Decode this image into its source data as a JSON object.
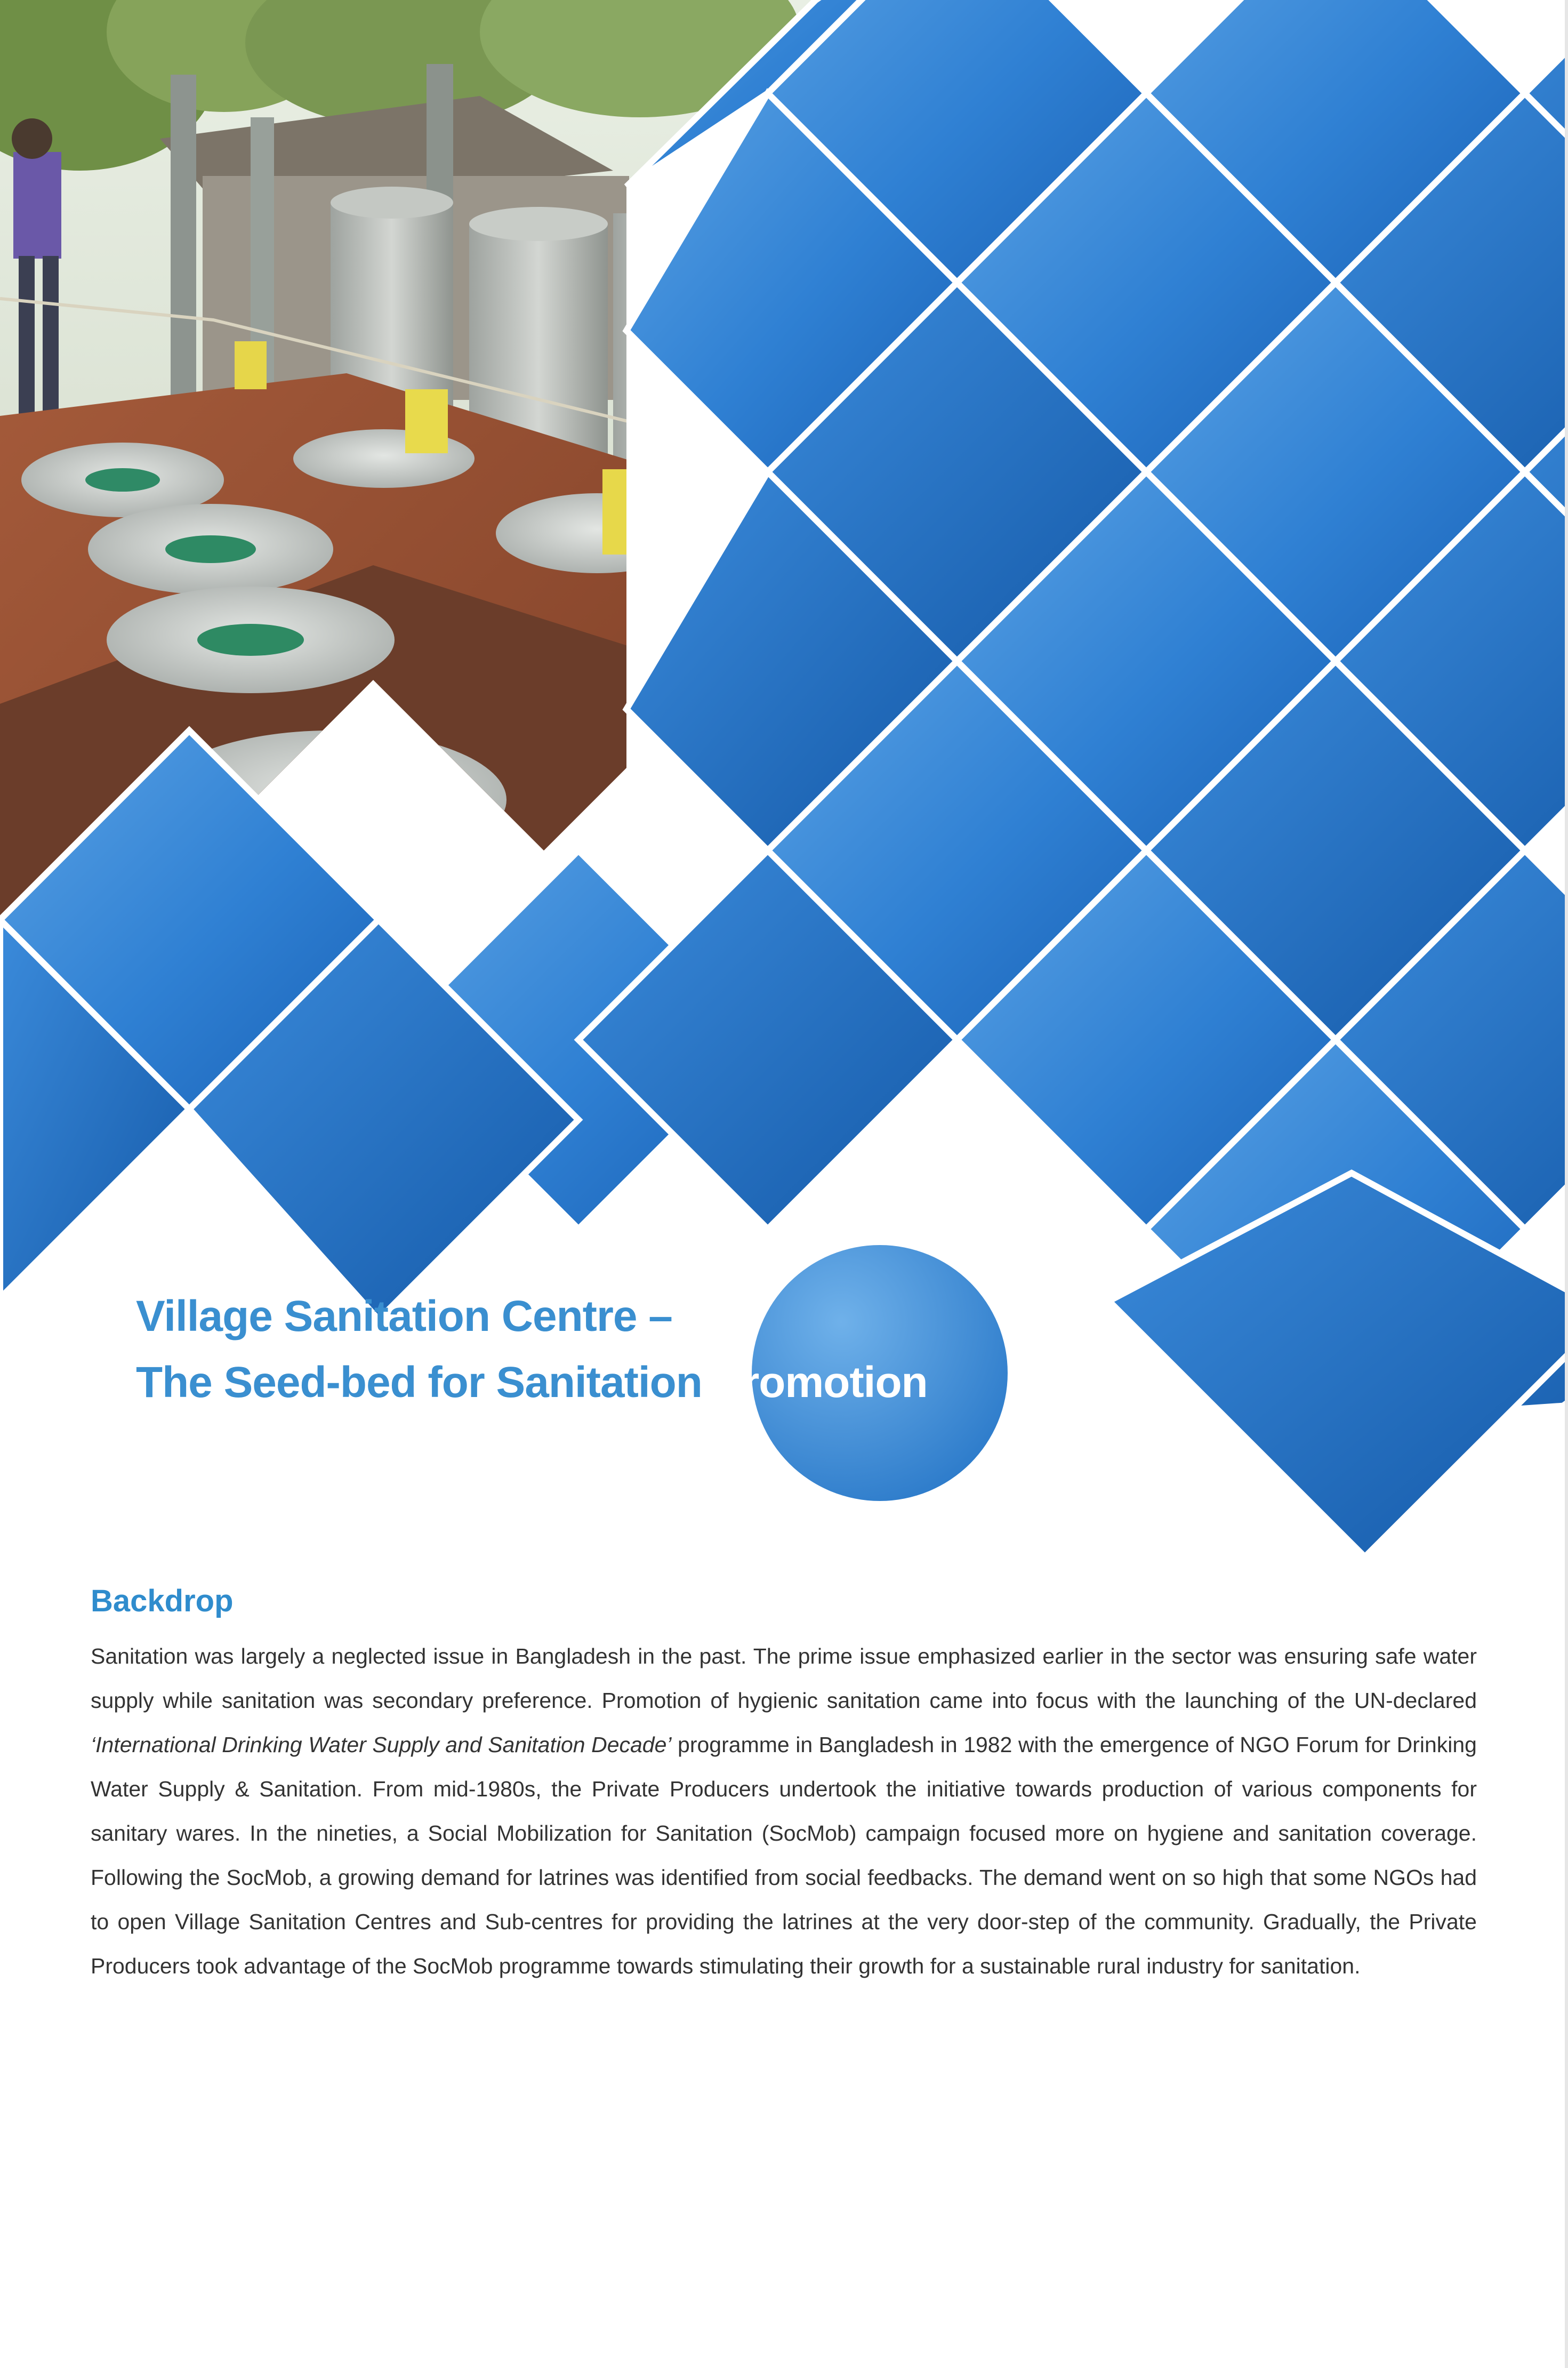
{
  "title": {
    "line1": "Village Sanitation Centre –",
    "line2_dark": "The Seed-bed for Sanitation ",
    "line2_light": "Promotion"
  },
  "section": {
    "heading": "Backdrop",
    "body_part1": "Sanitation was largely a neglected issue in Bangladesh in the past. The prime issue emphasized earlier in the sector was ensuring safe water supply while sanitation was secondary preference. Promotion of hygienic sanitation came into focus with the launching of the UN-declared ",
    "body_italic": "‘International Drinking Water Supply and Sanitation Decade’",
    "body_part2": " programme in Bangladesh in 1982 with the emergence of NGO Forum for Drinking Water Supply & Sanitation. From mid-1980s, the Private Producers undertook the initiative towards production of various components for sanitary wares. In the nineties, a Social Mobilization for Sanitation (SocMob) campaign focused more on hygiene and sanitation coverage. Following the SocMob, a growing demand for latrines was identified from social feedbacks. The demand went on so high that some NGOs had to open Village Sanitation Centres and Sub-centres for providing the latrines at the very door-step of the community. Gradually, the Private Producers took advantage of the SocMob programme towards stimulating their growth for a sustainable rural industry for sanitation."
  },
  "colors": {
    "brand_blue": "#1f6fc4",
    "brand_light_blue": "#5aa2e4",
    "title_blue": "#3a8fd0",
    "heading_blue": "#2f8ccd",
    "body_text": "#333333"
  }
}
